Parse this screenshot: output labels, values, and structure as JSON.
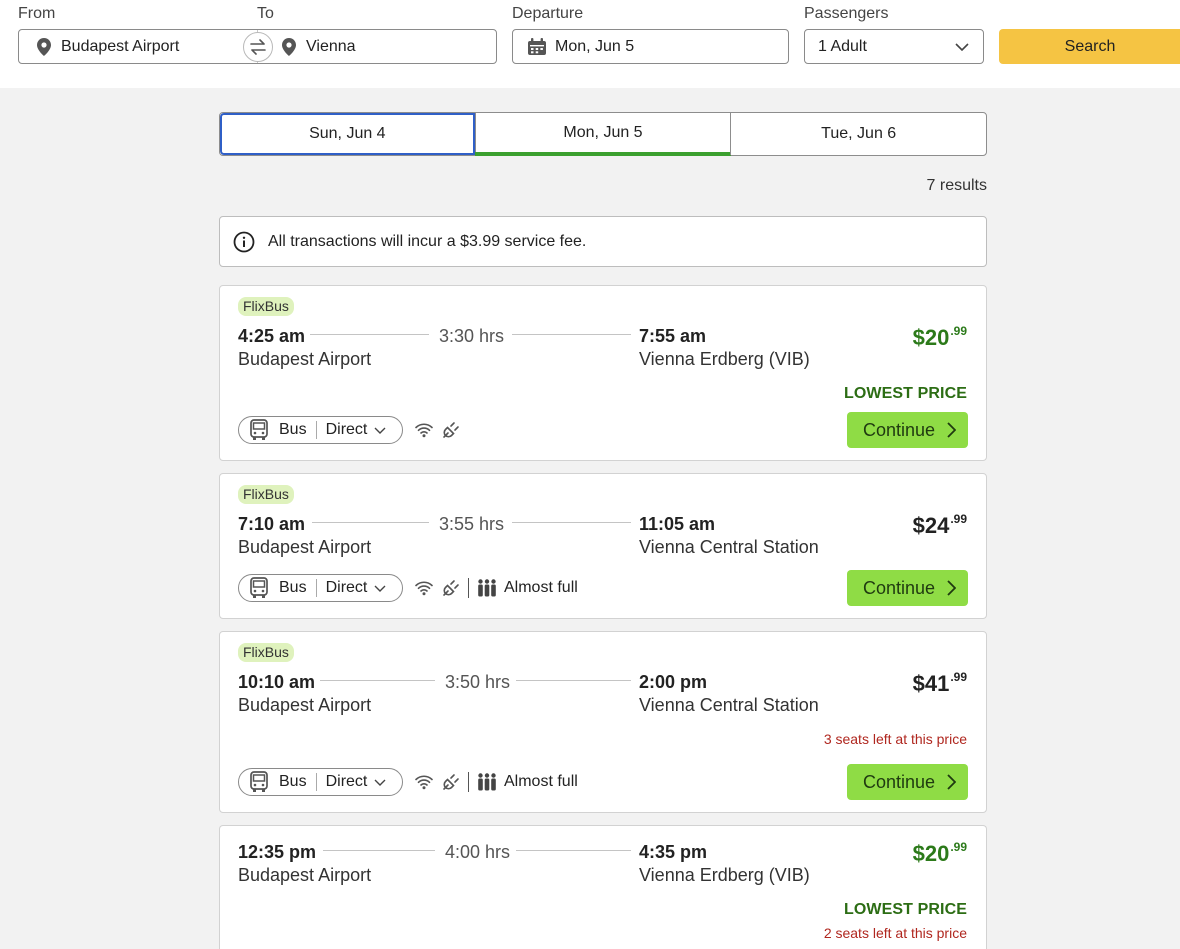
{
  "search": {
    "from_label": "From",
    "to_label": "To",
    "departure_label": "Departure",
    "passengers_label": "Passengers",
    "from_value": "Budapest Airport",
    "to_value": "Vienna",
    "departure_value": "Mon, Jun 5",
    "passengers_value": "1 Adult",
    "search_button": "Search"
  },
  "date_tabs": [
    {
      "label": "Sun, Jun 4"
    },
    {
      "label": "Mon, Jun 5"
    },
    {
      "label": "Tue, Jun 6"
    }
  ],
  "results_count": "7 results",
  "notice": "All transactions will incur a $3.99 service fee.",
  "colors": {
    "accent_green": "#3ba02f",
    "price_green": "#2c7a1a",
    "continue_green": "#8fdc45",
    "search_yellow": "#f5c443",
    "warning_red": "#b0271f",
    "operator_badge": "#dff2bd"
  },
  "icons": [
    "map-pin-icon",
    "swap-icon",
    "calendar-icon",
    "chevron-down-icon",
    "info-icon",
    "bus-icon",
    "wifi-icon",
    "power-plug-icon",
    "people-icon",
    "chevron-right-icon"
  ],
  "trips": [
    {
      "operator": "FlixBus",
      "depart_time": "4:25 am",
      "duration": "3:30 hrs",
      "arrive_time": "7:55 am",
      "depart_station": "Budapest Airport",
      "arrive_station": "Vienna Erdberg (VIB)",
      "price_main": "$20",
      "price_cents": ".99",
      "lowest_label": "LOWEST PRICE",
      "mode": "Bus",
      "route_type": "Direct",
      "continue_label": "Continue"
    },
    {
      "operator": "FlixBus",
      "depart_time": "7:10 am",
      "duration": "3:55 hrs",
      "arrive_time": "11:05 am",
      "depart_station": "Budapest Airport",
      "arrive_station": "Vienna Central Station",
      "price_main": "$24",
      "price_cents": ".99",
      "mode": "Bus",
      "route_type": "Direct",
      "capacity": "Almost full",
      "continue_label": "Continue"
    },
    {
      "operator": "FlixBus",
      "depart_time": "10:10 am",
      "duration": "3:50 hrs",
      "arrive_time": "2:00 pm",
      "depart_station": "Budapest Airport",
      "arrive_station": "Vienna Central Station",
      "price_main": "$41",
      "price_cents": ".99",
      "seats_left": "3 seats left at this price",
      "mode": "Bus",
      "route_type": "Direct",
      "capacity": "Almost full",
      "continue_label": "Continue"
    },
    {
      "depart_time": "12:35 pm",
      "duration": "4:00 hrs",
      "arrive_time": "4:35 pm",
      "depart_station": "Budapest Airport",
      "arrive_station": "Vienna Erdberg (VIB)",
      "price_main": "$20",
      "price_cents": ".99",
      "lowest_label": "LOWEST PRICE",
      "seats_left": "2 seats left at this price"
    }
  ]
}
